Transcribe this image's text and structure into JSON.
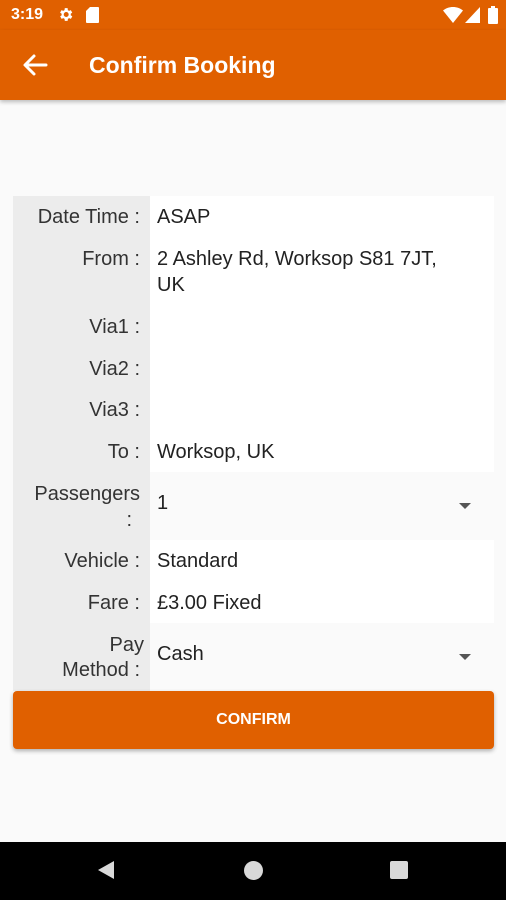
{
  "status_bar": {
    "time": "3:19",
    "icons": [
      "gear-icon",
      "sd-card-icon",
      "wifi-icon",
      "signal-icon",
      "battery-icon"
    ]
  },
  "app_bar": {
    "title": "Confirm Booking",
    "back_icon": "arrow-left-icon",
    "background_color": "#e06000"
  },
  "booking": {
    "date_time": {
      "label": "Date Time :",
      "value": "ASAP"
    },
    "from": {
      "label": "From :",
      "value_line1": "2 Ashley Rd, Worksop S81 7JT,",
      "value_line2": "UK"
    },
    "via1": {
      "label": "Via1 :",
      "value": ""
    },
    "via2": {
      "label": "Via2 :",
      "value": ""
    },
    "via3": {
      "label": "Via3 :",
      "value": ""
    },
    "to": {
      "label": "To :",
      "value": "Worksop, UK"
    },
    "passengers": {
      "label_line1": "Passengers",
      "label_line2": ":",
      "value": "1"
    },
    "vehicle": {
      "label": "Vehicle :",
      "value": "Standard"
    },
    "fare": {
      "label": "Fare :",
      "value": "£3.00 Fixed"
    },
    "pay_method": {
      "label_line1": "Pay",
      "label_line2": "Method :",
      "value": "Cash"
    }
  },
  "confirm_label": "CONFIRM",
  "nav_bar": {
    "icons": [
      "back-triangle-icon",
      "home-circle-icon",
      "recents-square-icon"
    ]
  }
}
